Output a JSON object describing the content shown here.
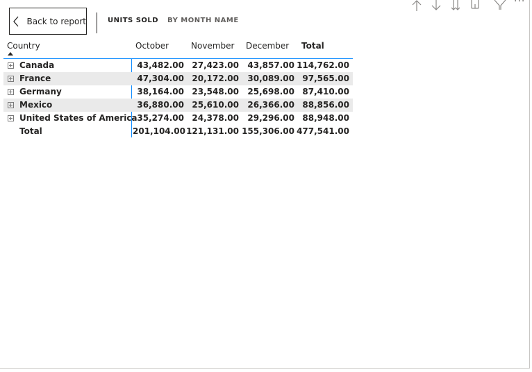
{
  "toolbar": {
    "back_label": "Back to report",
    "breadcrumb": [
      "UNITS SOLD",
      "BY MONTH NAME"
    ],
    "more_label": "···"
  },
  "matrix": {
    "headers": {
      "country": "Country",
      "months": [
        "October",
        "November",
        "December"
      ],
      "total": "Total"
    },
    "rows": [
      {
        "country": "Canada",
        "values": [
          "43,482.00",
          "27,423.00",
          "43,857.00"
        ],
        "total": "114,762.00"
      },
      {
        "country": "France",
        "values": [
          "47,304.00",
          "20,172.00",
          "30,089.00"
        ],
        "total": "97,565.00"
      },
      {
        "country": "Germany",
        "values": [
          "38,164.00",
          "23,548.00",
          "25,698.00"
        ],
        "total": "87,410.00"
      },
      {
        "country": "Mexico",
        "values": [
          "36,880.00",
          "25,610.00",
          "26,366.00"
        ],
        "total": "88,856.00"
      },
      {
        "country": "United States of America",
        "values": [
          "35,274.00",
          "24,378.00",
          "29,296.00"
        ],
        "total": "88,948.00"
      }
    ],
    "grand_total": {
      "label": "Total",
      "values": [
        "201,104.00",
        "121,131.00",
        "155,306.00"
      ],
      "total": "477,541.00"
    }
  },
  "colors": {
    "accent": "#118dff",
    "alt_row": "#eaeaea",
    "text": "#252423"
  }
}
